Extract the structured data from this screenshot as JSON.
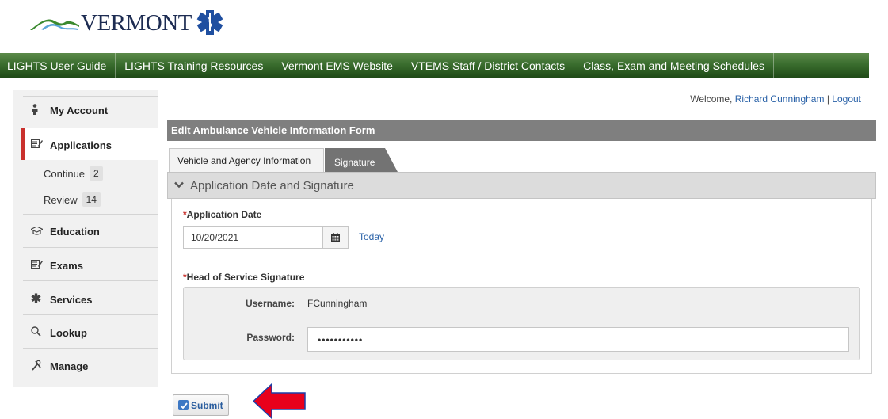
{
  "logo": {
    "text": "VERMONT",
    "star_icon": "star-of-life-icon",
    "mountain_icon": "mountain-icon"
  },
  "topnav": {
    "items": [
      "LIGHTS User Guide",
      "LIGHTS Training Resources",
      "Vermont EMS Website",
      "VTEMS Staff / District Contacts",
      "Class, Exam and Meeting Schedules"
    ]
  },
  "sidebar": {
    "my_account": "My Account",
    "applications": "Applications",
    "continue_label": "Continue",
    "continue_count": "2",
    "review_label": "Review",
    "review_count": "14",
    "education": "Education",
    "exams": "Exams",
    "services": "Services",
    "lookup": "Lookup",
    "manage": "Manage"
  },
  "header": {
    "welcome_prefix": "Welcome,",
    "user_name": "Richard Cunningham",
    "separator": "|",
    "logout": "Logout"
  },
  "form": {
    "title": "Edit Ambulance Vehicle Information Form",
    "tabs": [
      "Vehicle and Agency Information",
      "Signature"
    ],
    "active_tab": "Signature",
    "section_title": "Application Date and Signature",
    "required_mark": "*",
    "application_date_label": "Application Date",
    "application_date_value": "10/20/2021",
    "today_link": "Today",
    "signature_label": "Head of Service Signature",
    "username_label": "Username:",
    "username_value": "FCunningham",
    "password_label": "Password:",
    "password_value": "•••••••••••",
    "submit_label": "Submit"
  },
  "colors": {
    "nav_green": "#3a6d2e",
    "link_blue": "#2a62a8",
    "required_red": "#c9302c",
    "form_bar_gray": "#7f7f7f",
    "active_tab_dark": "#737373",
    "arrow_red": "#e8001c",
    "arrow_outline": "#1b3ea8"
  }
}
